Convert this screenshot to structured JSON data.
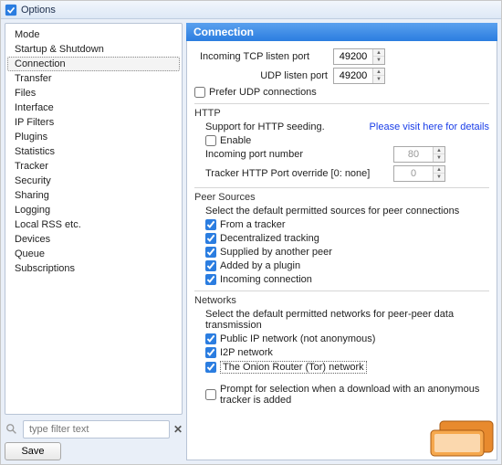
{
  "window": {
    "title": "Options"
  },
  "sidebar": {
    "items": [
      {
        "label": "Mode"
      },
      {
        "label": "Startup & Shutdown"
      },
      {
        "label": "Connection",
        "selected": true
      },
      {
        "label": "Transfer"
      },
      {
        "label": "Files"
      },
      {
        "label": "Interface"
      },
      {
        "label": "IP Filters"
      },
      {
        "label": "Plugins"
      },
      {
        "label": "Statistics"
      },
      {
        "label": "Tracker"
      },
      {
        "label": "Security"
      },
      {
        "label": "Sharing"
      },
      {
        "label": "Logging"
      },
      {
        "label": "Local RSS etc."
      },
      {
        "label": "Devices"
      },
      {
        "label": "Queue"
      },
      {
        "label": "Subscriptions"
      }
    ],
    "filter_placeholder": "type filter text",
    "save_label": "Save"
  },
  "content": {
    "header": "Connection",
    "tcp_port_label": "Incoming TCP listen port",
    "tcp_port_value": "49200",
    "udp_port_label": "UDP listen port",
    "udp_port_value": "49200",
    "prefer_udp_label": "Prefer UDP connections",
    "prefer_udp_checked": false,
    "http": {
      "title": "HTTP",
      "support_label": "Support for HTTP seeding.",
      "link_text": "Please visit here for details",
      "enable_label": "Enable",
      "enable_checked": false,
      "port_label": "Incoming port number",
      "port_value": "80",
      "override_label": "Tracker HTTP Port override [0: none]",
      "override_value": "0"
    },
    "peers": {
      "title": "Peer Sources",
      "desc": "Select the default permitted sources for peer connections",
      "items": [
        {
          "label": "From a tracker",
          "checked": true
        },
        {
          "label": "Decentralized tracking",
          "checked": true
        },
        {
          "label": "Supplied by another peer",
          "checked": true
        },
        {
          "label": "Added by a plugin",
          "checked": true
        },
        {
          "label": "Incoming connection",
          "checked": true
        }
      ]
    },
    "networks": {
      "title": "Networks",
      "desc": "Select the default permitted networks for peer-peer data transmission",
      "items": [
        {
          "label": "Public IP network (not anonymous)",
          "checked": true
        },
        {
          "label": "I2P network",
          "checked": true
        },
        {
          "label": "The Onion Router (Tor) network",
          "checked": true,
          "focused": true
        }
      ],
      "prompt_label": "Prompt for selection when a download with an anonymous tracker is added",
      "prompt_checked": false
    }
  }
}
